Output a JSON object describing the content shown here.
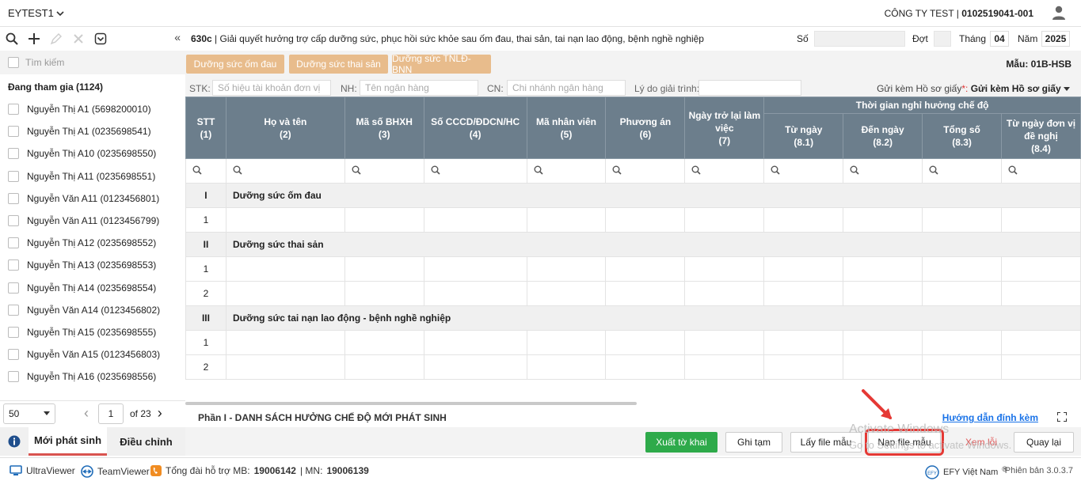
{
  "app": {
    "title": "EYTEST1",
    "company_name": "CÔNG TY TEST |",
    "company_code": "0102519041-001"
  },
  "left_panel": {
    "search_placeholder": "Tìm kiếm",
    "group_title": "Đang tham gia (1124)",
    "employees": [
      "Nguyễn Thị A1 (5698200010)",
      "Nguyễn Thị A1 (0235698541)",
      "Nguyễn Thị A10 (0235698550)",
      "Nguyễn Thị A11 (0235698551)",
      "Nguyễn Văn A11 (0123456801)",
      "Nguyễn Văn A11 (0123456799)",
      "Nguyễn Thị A12 (0235698552)",
      "Nguyễn Thị A13 (0235698553)",
      "Nguyễn Thị A14 (0235698554)",
      "Nguyễn Văn A14 (0123456802)",
      "Nguyễn Thị A15 (0235698555)",
      "Nguyễn Văn A15 (0123456803)",
      "Nguyễn Thị A16 (0235698556)"
    ],
    "pager": {
      "page_size": "50",
      "current_page": "1",
      "of_label": "of",
      "total_pages": "23"
    },
    "tabs": {
      "new": "Mới phát sinh",
      "adjust": "Điều chỉnh"
    }
  },
  "form": {
    "code": "630c",
    "title": "| Giải quyết hưởng trợ cấp dưỡng sức, phục hồi sức khỏe sau ốm đau, thai sản, tai nạn lao động, bệnh nghề nghiệp",
    "so_label": "Số",
    "dot_label": "Đợt",
    "thang_label": "Tháng",
    "thang_value": "04",
    "nam_label": "Năm",
    "nam_value": "2025",
    "tag_buttons": [
      "Dưỡng sức ốm đau",
      "Dưỡng sức thai sản",
      "Dưỡng sức TNLĐ-BNN"
    ],
    "mau": "Mẫu: 01B-HSB",
    "bank": {
      "stk_label": "STK:",
      "stk_placeholder": "Số hiệu tài khoản đơn vị",
      "nh_label": "NH:",
      "nh_placeholder": "Tên ngân hàng",
      "cn_label": "CN:",
      "cn_placeholder": "Chi nhánh ngân hàng",
      "lydo_label": "Lý do giải trình:",
      "gui_kem_label": "Gửi kèm Hồ sơ giấy",
      "gui_kem_required": "*:",
      "gui_kem_value": "Gửi kèm Hồ sơ giấy"
    }
  },
  "table": {
    "group_header": "Thời gian nghỉ hưởng chế độ",
    "columns": [
      {
        "name": "STT",
        "num": "(1)"
      },
      {
        "name": "Họ và tên",
        "num": "(2)"
      },
      {
        "name": "Mã số BHXH",
        "num": "(3)"
      },
      {
        "name": "Số CCCD/ĐDCN/HC",
        "num": "(4)"
      },
      {
        "name": "Mã nhân viên",
        "num": "(5)"
      },
      {
        "name": "Phương án",
        "num": "(6)"
      },
      {
        "name": "Ngày trở lại làm việc",
        "num": "(7)"
      }
    ],
    "sub_columns": [
      {
        "name": "Từ ngày",
        "num": "(8.1)"
      },
      {
        "name": "Đến ngày",
        "num": "(8.2)"
      },
      {
        "name": "Tổng số",
        "num": "(8.3)"
      },
      {
        "name": "Từ ngày đơn vị đề nghị",
        "num": "(8.4)"
      }
    ],
    "sections": [
      {
        "roman": "I",
        "title": "Dưỡng sức ốm đau",
        "rows": [
          "1"
        ]
      },
      {
        "roman": "II",
        "title": "Dưỡng sức thai sản",
        "rows": [
          "1",
          "2"
        ]
      },
      {
        "roman": "III",
        "title": "Dưỡng sức tai nạn lao động - bệnh nghề nghiệp",
        "rows": [
          "1",
          "2"
        ]
      }
    ]
  },
  "part": {
    "title": "Phần I - DANH SÁCH HƯỞNG CHẾ ĐỘ MỚI PHÁT SINH",
    "guide_link": "Hướng dẫn đính kèm"
  },
  "actions": {
    "xuat": "Xuất tờ khai",
    "ghi_tam": "Ghi tạm",
    "lay_file": "Lấy file mẫu",
    "nap_file": "Nạp file mẫu",
    "xem_loi": "Xem lỗi",
    "quay_lai": "Quay lại"
  },
  "watermark": {
    "line1": "Activate Windows",
    "line2": "Go to Settings to activate Windows."
  },
  "status": {
    "ultraviewer": "UltraViewer",
    "teamviewer": "TeamViewer",
    "hotline_label": "Tổng đài hỗ trợ MB:",
    "mb_number": "19006142",
    "mn_label": "| MN:",
    "mn_number": "19006139",
    "brand": "EFY Việt Nam",
    "version": "Phiên bản 3.0.3.7"
  },
  "colors": {
    "header_bg": "#6c7e8c",
    "tag_btn": "#e8bc8c",
    "primary_green": "#2eaa4a",
    "tab_accent": "#d9534f",
    "link": "#1a73e8",
    "highlight_red": "#e53935"
  }
}
